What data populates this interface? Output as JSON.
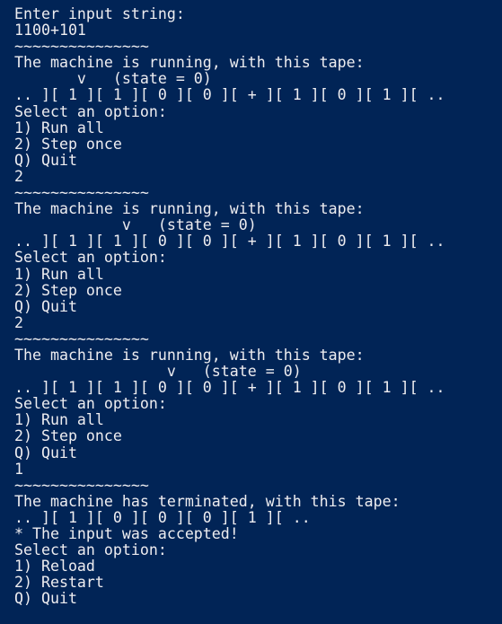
{
  "terminal": {
    "background": "#012456",
    "foreground": "#eeedf0",
    "lines": [
      "Enter input string:",
      "1100+101",
      "~~~~~~~~~~~~~~~",
      "The machine is running, with this tape:",
      "       v   (state = 0)",
      ".. ][ 1 ][ 1 ][ 0 ][ 0 ][ + ][ 1 ][ 0 ][ 1 ][ ..",
      "Select an option:",
      "1) Run all",
      "2) Step once",
      "Q) Quit",
      "2",
      "~~~~~~~~~~~~~~~",
      "The machine is running, with this tape:",
      "            v   (state = 0)",
      ".. ][ 1 ][ 1 ][ 0 ][ 0 ][ + ][ 1 ][ 0 ][ 1 ][ ..",
      "Select an option:",
      "1) Run all",
      "2) Step once",
      "Q) Quit",
      "2",
      "~~~~~~~~~~~~~~~",
      "The machine is running, with this tape:",
      "                 v   (state = 0)",
      ".. ][ 1 ][ 1 ][ 0 ][ 0 ][ + ][ 1 ][ 0 ][ 1 ][ ..",
      "Select an option:",
      "1) Run all",
      "2) Step once",
      "Q) Quit",
      "1",
      "~~~~~~~~~~~~~~~",
      "The machine has terminated, with this tape:",
      ".. ][ 1 ][ 0 ][ 0 ][ 0 ][ 1 ][ ..",
      "* The input was accepted!",
      "Select an option:",
      "1) Reload",
      "2) Restart",
      "Q) Quit"
    ]
  }
}
